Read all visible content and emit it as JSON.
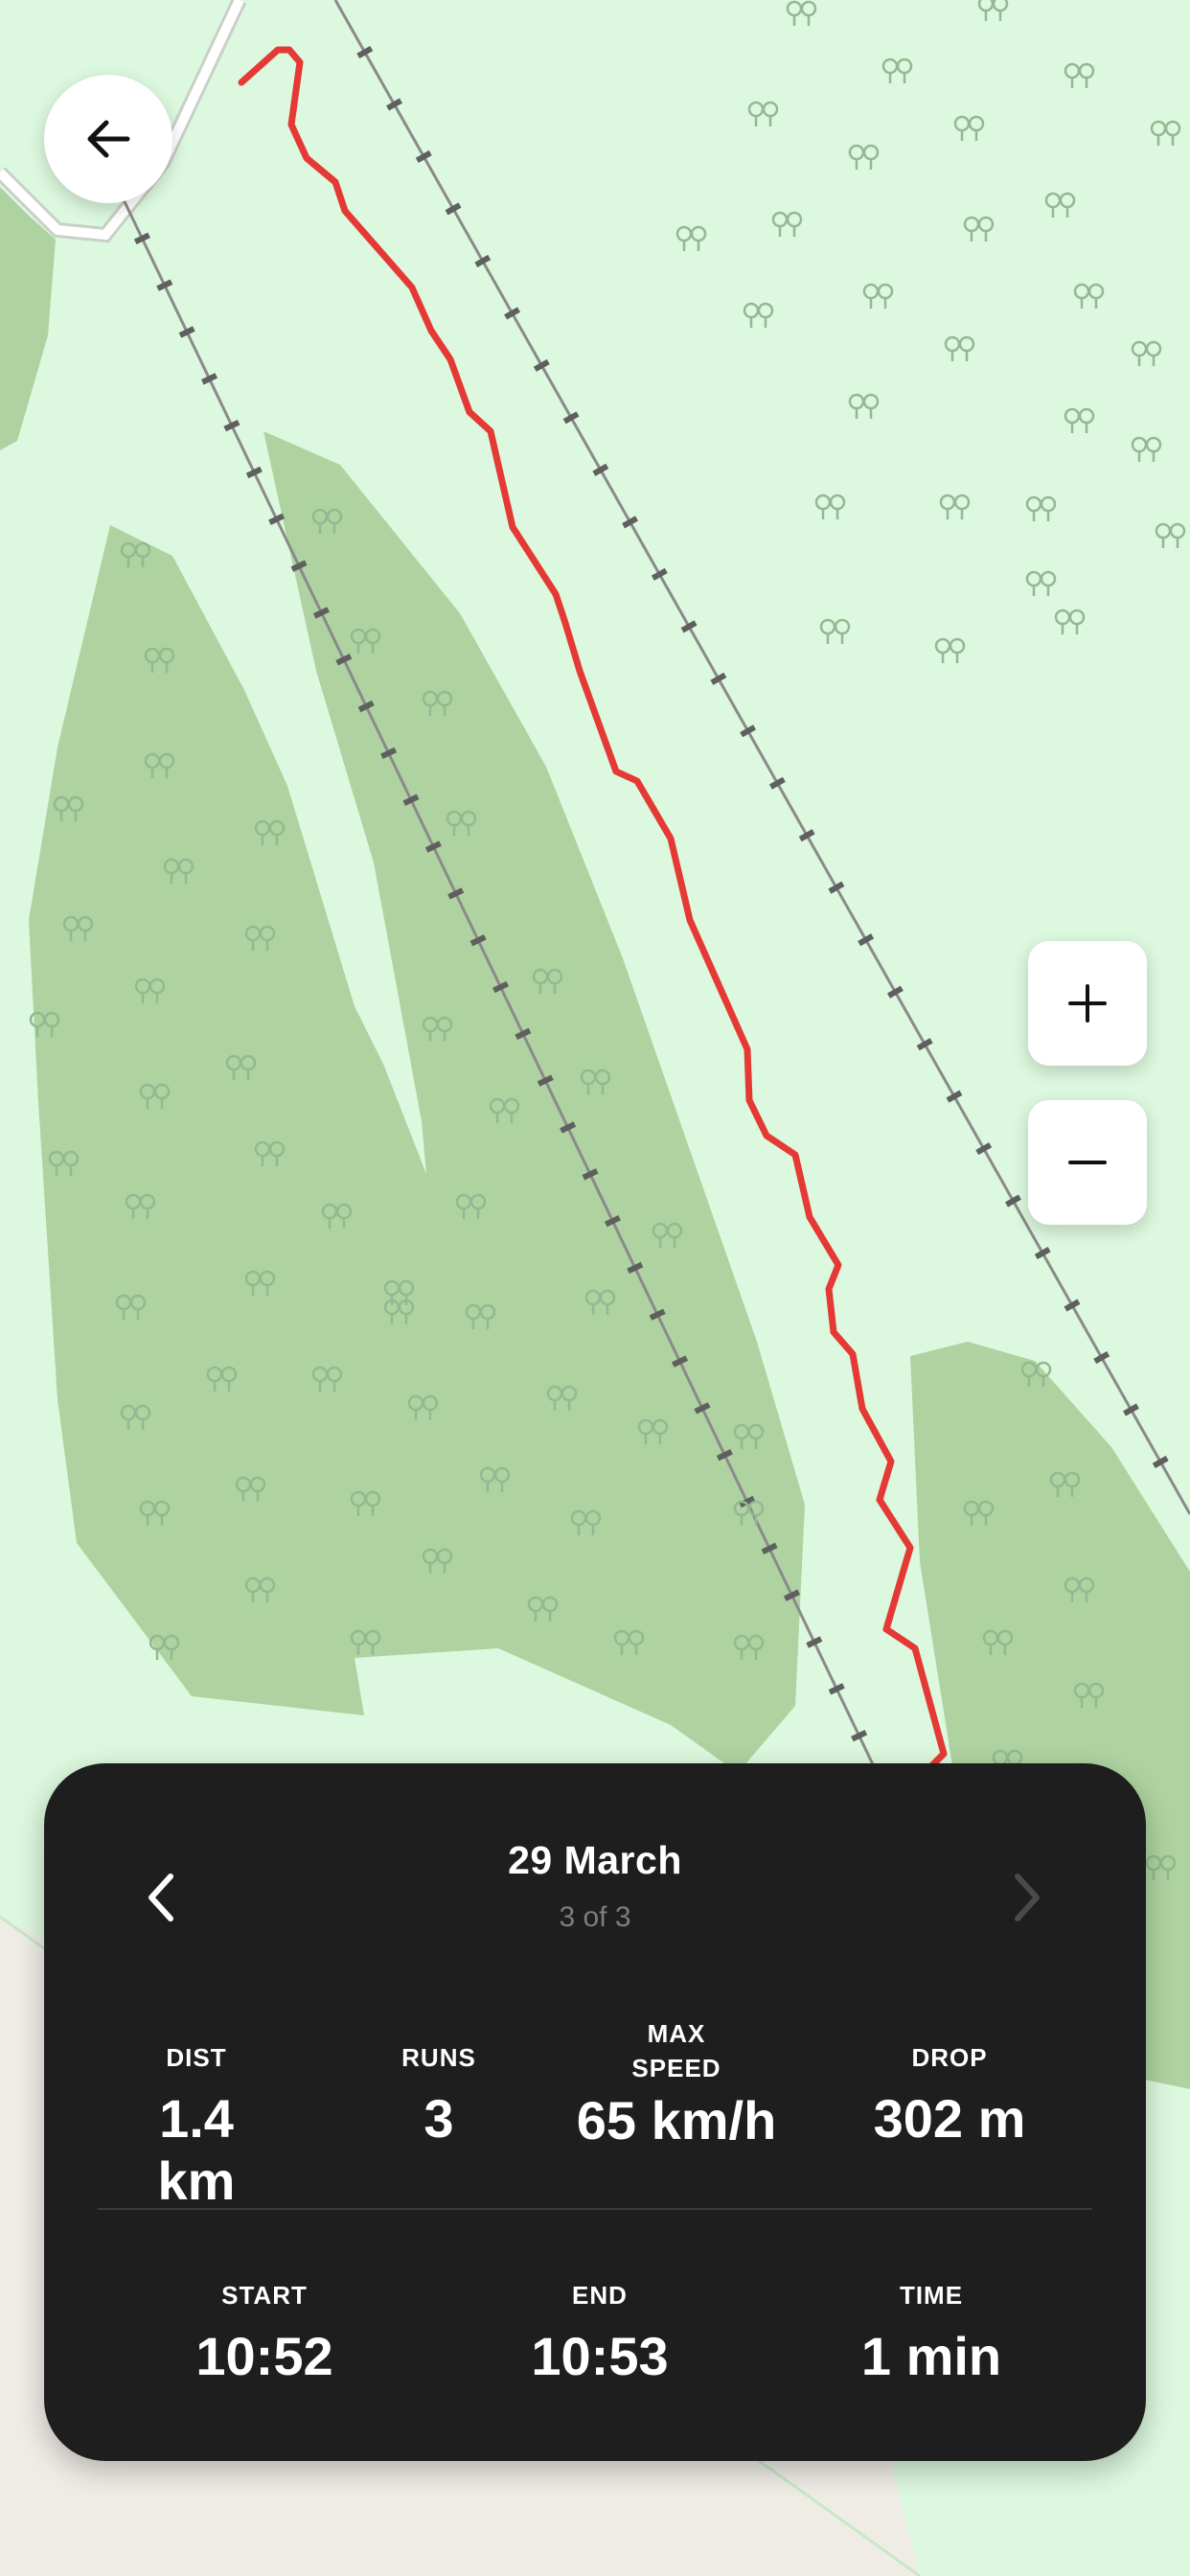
{
  "map": {
    "colors": {
      "meadow": "#dcf8de",
      "forest": "#aed3a0",
      "track": "#e53935",
      "lift": "#8a8a8a",
      "road": "#ffffff",
      "urban": "#efece6"
    }
  },
  "controls": {
    "back_icon": "arrow-left-icon",
    "zoom_in_icon": "plus-icon",
    "zoom_out_icon": "minus-icon"
  },
  "panel": {
    "date": "29 March",
    "position": "3 of 3",
    "prev_icon": "chevron-left-icon",
    "next_icon": "chevron-right-icon",
    "stats_row1": {
      "dist": {
        "label": "DIST",
        "value": "1.4 km"
      },
      "runs": {
        "label": "RUNS",
        "value": "3"
      },
      "max_speed": {
        "label": "MAX SPEED",
        "value": "65 km/h"
      },
      "drop": {
        "label": "DROP",
        "value": "302 m"
      }
    },
    "stats_row2": {
      "start": {
        "label": "START",
        "value": "10:52"
      },
      "end": {
        "label": "END",
        "value": "10:53"
      },
      "time": {
        "label": "TIME",
        "value": "1 min"
      }
    }
  }
}
